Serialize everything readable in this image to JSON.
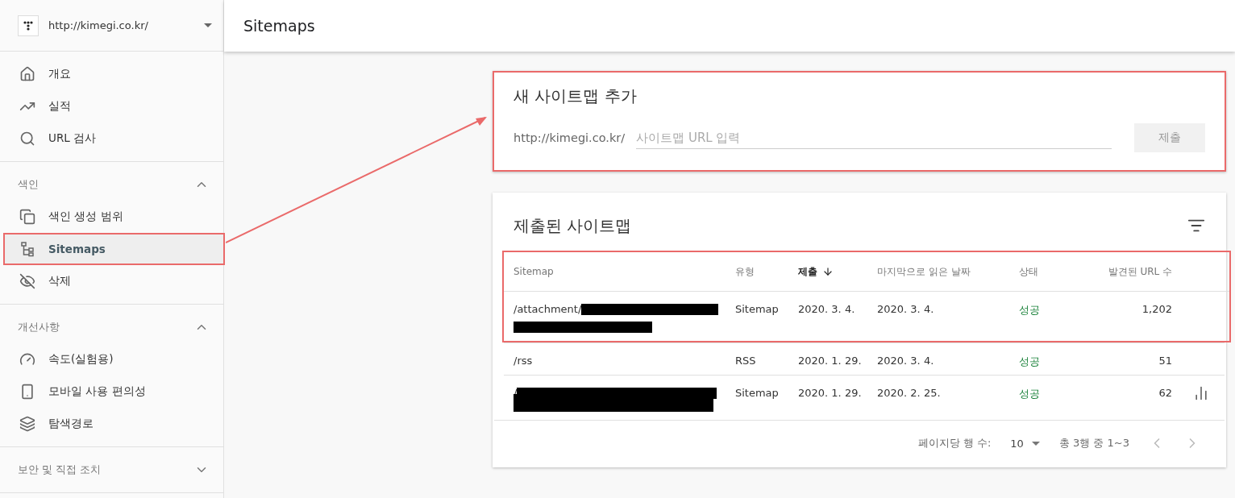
{
  "property": {
    "url": "http://kimegi.co.kr/"
  },
  "sidebar": {
    "sections": [
      {
        "items": [
          {
            "label": "개요",
            "selected": false,
            "highlighted": false
          },
          {
            "label": "실적",
            "selected": false,
            "highlighted": false
          },
          {
            "label": "URL 검사",
            "selected": false,
            "highlighted": false
          }
        ]
      },
      {
        "title": "색인",
        "expanded": true,
        "items": [
          {
            "label": "색인 생성 범위",
            "selected": false,
            "highlighted": false
          },
          {
            "label": "Sitemaps",
            "selected": true,
            "highlighted": true
          },
          {
            "label": "삭제",
            "selected": false,
            "highlighted": false
          }
        ]
      },
      {
        "title": "개선사항",
        "expanded": true,
        "items": [
          {
            "label": "속도(실험용)",
            "selected": false,
            "highlighted": false
          },
          {
            "label": "모바일 사용 편의성",
            "selected": false,
            "highlighted": false
          },
          {
            "label": "탐색경로",
            "selected": false,
            "highlighted": false
          }
        ]
      },
      {
        "title": "보안 및 직접 조치",
        "expanded": false
      }
    ]
  },
  "page": {
    "title": "Sitemaps"
  },
  "add_card": {
    "title": "새 사이트맵 추가",
    "highlighted": true,
    "prefix": "http://kimegi.co.kr/",
    "placeholder": "사이트맵 URL 입력",
    "submit": "제출",
    "submit_disabled": true
  },
  "table_card": {
    "title": "제출된 사이트맵",
    "columns": [
      {
        "label": "Sitemap",
        "sorted": false
      },
      {
        "label": "유형",
        "sorted": false
      },
      {
        "label": "제출",
        "sorted": true
      },
      {
        "label": "마지막으로 읽은 날짜",
        "sorted": false
      },
      {
        "label": "상태",
        "sorted": false
      },
      {
        "label": "발견된 URL 수",
        "sorted": false
      }
    ],
    "header_highlighted": true,
    "rows": [
      {
        "sitemap": "/attachment/",
        "redacted": true,
        "type": "Sitemap",
        "submitted": "2020. 3. 4.",
        "last_read": "2020. 3. 4.",
        "status": "성공",
        "urls": "1,202",
        "chart_button": false
      },
      {
        "sitemap": "/rss",
        "redacted": false,
        "type": "RSS",
        "submitted": "2020. 1. 29.",
        "last_read": "2020. 3. 4.",
        "status": "성공",
        "urls": "51",
        "chart_button": false
      },
      {
        "sitemap": "/",
        "redacted": true,
        "type": "Sitemap",
        "submitted": "2020. 1. 29.",
        "last_read": "2020. 2. 25.",
        "status": "성공",
        "urls": "62",
        "chart_button": true
      }
    ],
    "footer": {
      "rows_label": "페이지당 행 수:",
      "rows_value": "10",
      "range": "총 3행 중 1~3"
    }
  },
  "annotation": {
    "arrow": true
  }
}
